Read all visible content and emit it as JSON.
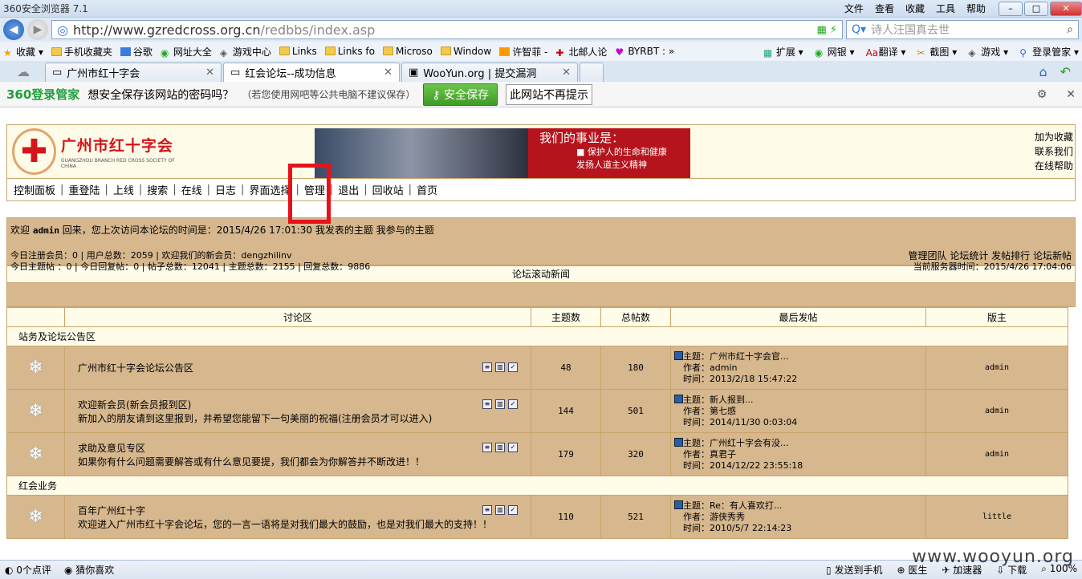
{
  "browser": {
    "title": "360安全浏览器 7.1",
    "menu": [
      "文件",
      "查看",
      "收藏",
      "工具",
      "帮助"
    ],
    "url_host": "http://www.gzredcross.org.cn",
    "url_path": "/redbbs/index.asp",
    "search": "诗人汪国真去世",
    "bookmarks": [
      "收藏",
      "手机收藏夹",
      "谷歌",
      "网址大全",
      "游戏中心",
      "Links",
      "Links fo",
      "Microso",
      "Window",
      "许智菲 -",
      "北邮人论",
      "BYRBT :"
    ],
    "toolbar_right": [
      "扩展",
      "网银",
      "翻译",
      "截图",
      "游戏",
      "登录管家"
    ],
    "tabs": [
      "广州市红十字会",
      "红会论坛--成功信息",
      "WooYun.org | 提交漏洞"
    ]
  },
  "pwbar": {
    "brand": "360登录管家",
    "question": "想安全保存该网站的密码吗？",
    "note": "（若您使用网吧等公共电脑不建议保存）",
    "save": "安全保存",
    "dont": "此网站不再提示"
  },
  "site": {
    "logo_name": "广州市红十字会",
    "logo_en": "GUANGZHOU BRANCH RED CROSS SOCIETY OF CHINA",
    "banner_head": "我们的事业是：",
    "banner_l1": "■ 保护人的生命和健康",
    "banner_l2": "发扬人道主义精神",
    "links": [
      "加为收藏",
      "联系我们",
      "在线帮助"
    ],
    "menu": [
      "控制面板",
      "重登陆",
      "上线",
      "搜索",
      "在线",
      "日志",
      "界面选择",
      "管理",
      "退出",
      "回收站",
      "首页"
    ]
  },
  "welcome": {
    "pre": "欢迎",
    "user": "admin",
    "post": "回来，您上次访问本论坛的时间是：2015/4/26 17:01:30",
    "my_topics": "我发表的主题",
    "my_part": "我参与的主题",
    "stats1": "今日注册会员：0 | 用户总数：2059 | 欢迎我们的新会员：dengzhilinv",
    "stats2": "今日主题帖 ：0 | 今日回复帖：0 | 帖子总数：12041 | 主题总数：2155 | 回复总数：9886",
    "right1": "管理团队 论坛统计 发帖排行 论坛新帖",
    "right2": "当前服务器时间：2015/4/26 17:04:06"
  },
  "news": "论坛滚动新闻",
  "forum": {
    "headers": [
      "讨论区",
      "主题数",
      "总帖数",
      "最后发帖",
      "版主"
    ],
    "cat1": "站务及论坛公告区",
    "cat2": "红会业务",
    "rows": [
      {
        "name": "广州市红十字会论坛公告区",
        "desc": "",
        "topics": "48",
        "posts": "180",
        "lt": "主题：广州市红十字会官...",
        "la": "作者：admin",
        "ld": "时间：2013/2/18 15:47:22",
        "mod": "admin"
      },
      {
        "name": "欢迎新会员(新会员报到区)",
        "desc": "新加入的朋友请到这里报到，并希望您能留下一句美丽的祝福(注册会员才可以进入)",
        "topics": "144",
        "posts": "501",
        "lt": "主题：新人报到...",
        "la": "作者：第七感",
        "ld": "时间：2014/11/30 0:03:04",
        "mod": "admin"
      },
      {
        "name": "求助及意见专区",
        "desc": "如果你有什么问题需要解答或有什么意见要提，我们都会为你解答并不断改进！！",
        "topics": "179",
        "posts": "320",
        "lt": "主题：广州红十字会有没...",
        "la": "作者：真君子",
        "ld": "时间：2014/12/22 23:55:18",
        "mod": "admin"
      },
      {
        "name": "百年广州红十字",
        "desc": "欢迎进入广州市红十字会论坛，您的一言一语将是对我们最大的鼓励，也是对我们最大的支持！！",
        "topics": "110",
        "posts": "521",
        "lt": "主题：Re：有人喜欢打...",
        "la": "作者：游侠秀秀",
        "ld": "时间：2010/5/7 22:14:23",
        "mod": "little"
      }
    ]
  },
  "status": {
    "comments": "0个点评",
    "guess": "猜你喜欢",
    "right": [
      "发送到手机",
      "医生",
      "加速器",
      "下载",
      "100%"
    ]
  },
  "watermark": "www.wooyun.org"
}
